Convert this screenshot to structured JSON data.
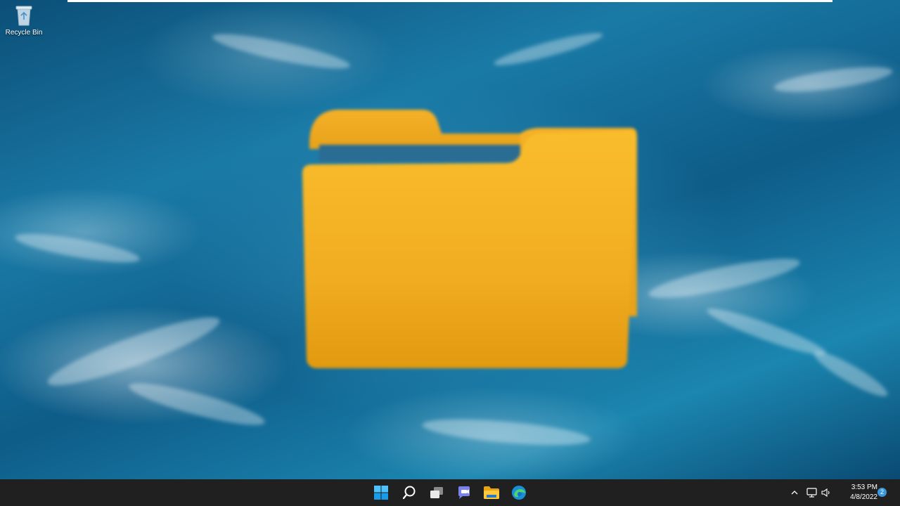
{
  "desktop": {
    "icons": [
      {
        "label": "Recycle Bin",
        "icon": "recycle-bin-icon"
      }
    ],
    "overlay_icon": "folder-icon",
    "wallpaper": "ocean-waves",
    "colors": {
      "folder": "#f5b52a",
      "folder_dark": "#e29d12",
      "taskbar": "#202020",
      "accent": "#3a96dd"
    }
  },
  "taskbar": {
    "pinned": [
      {
        "name": "start",
        "icon": "windows-start-icon"
      },
      {
        "name": "search",
        "icon": "search-icon"
      },
      {
        "name": "task-view",
        "icon": "task-view-icon"
      },
      {
        "name": "chat",
        "icon": "teams-chat-icon"
      },
      {
        "name": "file-explorer",
        "icon": "file-explorer-icon"
      },
      {
        "name": "edge",
        "icon": "edge-browser-icon"
      }
    ],
    "tray": {
      "icons": [
        "chevron-up-icon",
        "network-icon",
        "volume-icon"
      ],
      "time": "3:53 PM",
      "date": "4/8/2022",
      "notifications": "2"
    }
  }
}
